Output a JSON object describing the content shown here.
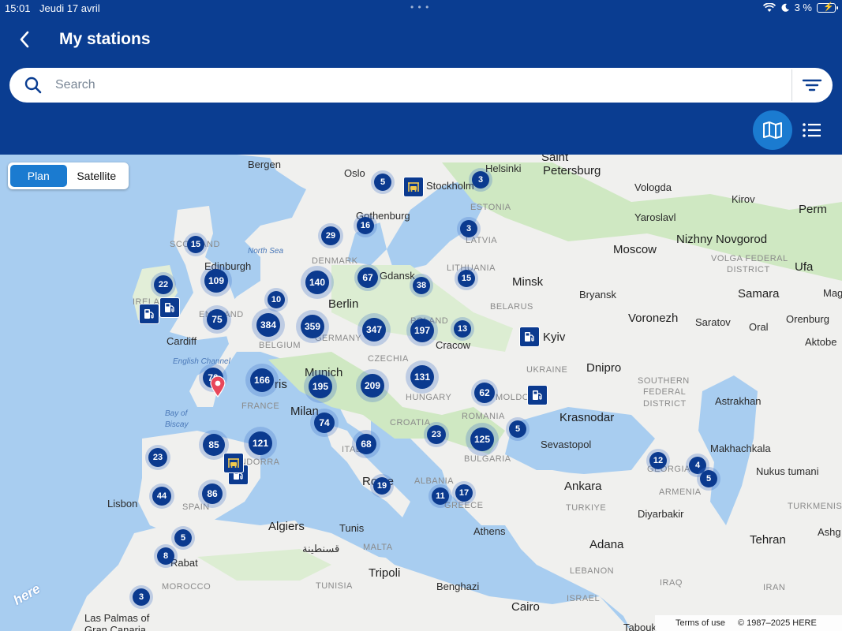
{
  "status": {
    "time": "15:01",
    "date": "Jeudi 17 avril",
    "battery": "3 %"
  },
  "header": {
    "title": "My stations"
  },
  "search": {
    "placeholder": "Search"
  },
  "map_toggle": {
    "plan": "Plan",
    "satellite": "Satellite"
  },
  "footer": {
    "terms": "Terms of use",
    "copyright": "© 1987–2025 HERE"
  },
  "brand": {
    "logo": "here"
  },
  "colors": {
    "header": "#0a3d91",
    "accent": "#1b7bd0",
    "cluster": "#0b3a8f",
    "pin": "#e8475a"
  },
  "places": [
    {
      "t": "Bergen"
    },
    {
      "t": "Oslo"
    },
    {
      "t": "Stockholm"
    },
    {
      "t": "Helsinki"
    },
    {
      "t": "Saint"
    },
    {
      "t": "Petersburg"
    },
    {
      "t": "Vologda"
    },
    {
      "t": "Kirov"
    },
    {
      "t": "Perm"
    },
    {
      "t": "Yaroslavl"
    },
    {
      "t": "Nizhny Novgorod"
    },
    {
      "t": "Moscow"
    },
    {
      "t": "Gothenburg"
    },
    {
      "t": "Edinburgh"
    },
    {
      "t": "Gdansk"
    },
    {
      "t": "Minsk"
    },
    {
      "t": "Ufa"
    },
    {
      "t": "Samara"
    },
    {
      "t": "Berlin"
    },
    {
      "t": "Bryansk"
    },
    {
      "t": "Voronezh"
    },
    {
      "t": "Saratov"
    },
    {
      "t": "Oral"
    },
    {
      "t": "Orenburg"
    },
    {
      "t": "Cardiff"
    },
    {
      "t": "Cracow"
    },
    {
      "t": "Kyiv"
    },
    {
      "t": "Aktobe"
    },
    {
      "t": "Munich"
    },
    {
      "t": "Dnipro"
    },
    {
      "t": "ris"
    },
    {
      "t": "Milan"
    },
    {
      "t": "Krasnodar"
    },
    {
      "t": "Astrakhan"
    },
    {
      "t": "Sevastopol"
    },
    {
      "t": "Makhachkala"
    },
    {
      "t": "Nukus tumani"
    },
    {
      "t": "Rome"
    },
    {
      "t": "Ankara"
    },
    {
      "t": "Lisbon"
    },
    {
      "t": "Diyarbakir"
    },
    {
      "t": "Algiers"
    },
    {
      "t": "Tunis"
    },
    {
      "t": "Athens"
    },
    {
      "t": "Adana"
    },
    {
      "t": "Tehran"
    },
    {
      "t": "Rabat"
    },
    {
      "t": "قسنطينة"
    },
    {
      "t": "Tripoli"
    },
    {
      "t": "Benghazi"
    },
    {
      "t": "Cairo"
    },
    {
      "t": "Tabouk"
    },
    {
      "t": "Las Palmas of"
    },
    {
      "t": "Gran Canaria"
    },
    {
      "t": "Ashg"
    },
    {
      "t": "Mag"
    }
  ],
  "regions": [
    {
      "t": "ESTONIA"
    },
    {
      "t": "LATVIA"
    },
    {
      "t": "LITHUANIA"
    },
    {
      "t": "DENMARK"
    },
    {
      "t": "BELARUS"
    },
    {
      "t": "SCOTLAND"
    },
    {
      "t": "IRELAND"
    },
    {
      "t": "ENGLAND"
    },
    {
      "t": "BELGIUM"
    },
    {
      "t": "GERMANY"
    },
    {
      "t": "POLAND"
    },
    {
      "t": "CZECHIA"
    },
    {
      "t": "UKRAINE"
    },
    {
      "t": "FRANCE"
    },
    {
      "t": "HUNGARY"
    },
    {
      "t": "MOLDOVA"
    },
    {
      "t": "ROMANIA"
    },
    {
      "t": "CROATIA"
    },
    {
      "t": "ITALY"
    },
    {
      "t": "BULGARIA"
    },
    {
      "t": "ANDORRA"
    },
    {
      "t": "SPAIN"
    },
    {
      "t": "ALBANIA"
    },
    {
      "t": "GREECE"
    },
    {
      "t": "TURKIYE"
    },
    {
      "t": "GEORGIA"
    },
    {
      "t": "ARMENIA"
    },
    {
      "t": "MALTA"
    },
    {
      "t": "TUNISIA"
    },
    {
      "t": "LEBANON"
    },
    {
      "t": "MOROCCO"
    },
    {
      "t": "ISRAEL"
    },
    {
      "t": "IRAQ"
    },
    {
      "t": "IRAN"
    },
    {
      "t": "VOLGA FEDERAL"
    },
    {
      "t": "DISTRICT"
    },
    {
      "t": "SOUTHERN"
    },
    {
      "t": "FEDERAL"
    },
    {
      "t": "DISTRICT"
    },
    {
      "t": "TURKMENIST"
    }
  ],
  "seas": [
    {
      "t": "North Sea"
    },
    {
      "t": "English Channel"
    },
    {
      "t": "Bay of"
    },
    {
      "t": "Biscay"
    }
  ],
  "clusters": [
    {
      "n": "5"
    },
    {
      "n": "3"
    },
    {
      "n": "16"
    },
    {
      "n": "3"
    },
    {
      "n": "15"
    },
    {
      "n": "29"
    },
    {
      "n": "22"
    },
    {
      "n": "109"
    },
    {
      "n": "140"
    },
    {
      "n": "67"
    },
    {
      "n": "38"
    },
    {
      "n": "15"
    },
    {
      "n": "10"
    },
    {
      "n": "75"
    },
    {
      "n": "384"
    },
    {
      "n": "359"
    },
    {
      "n": "347"
    },
    {
      "n": "197"
    },
    {
      "n": "13"
    },
    {
      "n": "70"
    },
    {
      "n": "166"
    },
    {
      "n": "195"
    },
    {
      "n": "209"
    },
    {
      "n": "131"
    },
    {
      "n": "62"
    },
    {
      "n": "74"
    },
    {
      "n": "85"
    },
    {
      "n": "121"
    },
    {
      "n": "68"
    },
    {
      "n": "23"
    },
    {
      "n": "125"
    },
    {
      "n": "5"
    },
    {
      "n": "23"
    },
    {
      "n": "12"
    },
    {
      "n": "4"
    },
    {
      "n": "5"
    },
    {
      "n": "86"
    },
    {
      "n": "19"
    },
    {
      "n": "11"
    },
    {
      "n": "17"
    },
    {
      "n": "44"
    },
    {
      "n": "5"
    },
    {
      "n": "8"
    },
    {
      "n": "3"
    }
  ]
}
